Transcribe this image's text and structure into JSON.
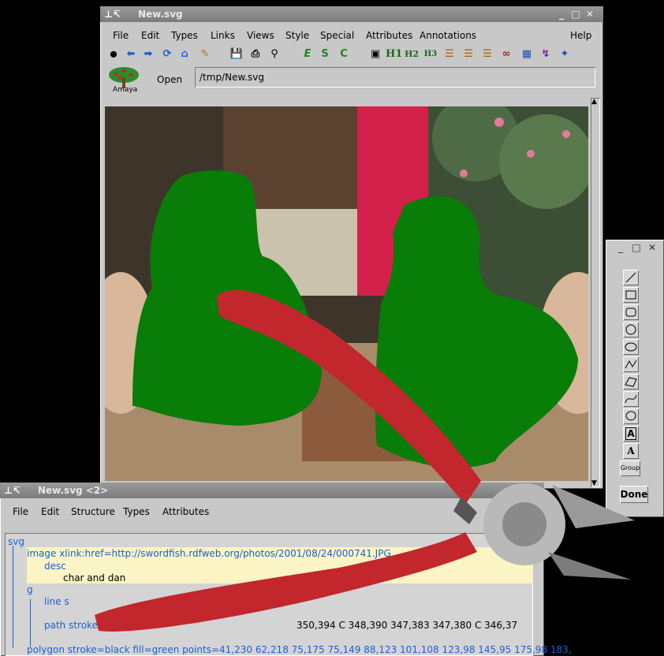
{
  "main_window": {
    "title": "New.svg",
    "menu": [
      "File",
      "Edit",
      "Types",
      "Links",
      "Views",
      "Style",
      "Special",
      "Attributes",
      "Annotations",
      "Help"
    ],
    "toolbar_icons": [
      "stop-icon",
      "back-icon",
      "forward-icon",
      "reload-icon",
      "home-icon",
      "edit-icon",
      "save-icon",
      "print-icon",
      "find-icon",
      "emphasis-icon",
      "strong-icon",
      "code-icon",
      "image-icon",
      "h1-icon",
      "h2-icon",
      "h3-icon",
      "list-icon",
      "numbered-list-icon",
      "definition-list-icon",
      "link-icon",
      "table-icon",
      "math-icon",
      "graphics-icon"
    ],
    "toolbar_glyphs": {
      "emph": "E",
      "strong": "S",
      "code": "C",
      "h1": "H1",
      "h2": "H2",
      "h3": "H3"
    },
    "logo_label": "Amaya",
    "open_label": "Open",
    "url_value": "/tmp/New.svg"
  },
  "palette": {
    "tools": [
      "line-tool",
      "rect-tool",
      "rounded-rect-tool",
      "circle-tool",
      "ellipse-tool",
      "polyline-tool",
      "polygon-tool",
      "curve-tool",
      "closed-curve-tool",
      "foreign-text-tool",
      "text-tool",
      "group-tool"
    ],
    "text_tool_label": "A",
    "group_label": "Group",
    "done_label": "Done"
  },
  "structure_window": {
    "title": "New.svg <2>",
    "menu": [
      "File",
      "Edit",
      "Structure",
      "Types",
      "Attributes"
    ],
    "tree": {
      "svg": "svg",
      "image_line": "image xlink:href=http://swordfish.rdfweb.org/photos/2001/08/24/000741.JPG",
      "desc": "desc",
      "desc_text": "char  and dan",
      "g": "g",
      "line": "line s",
      "path": "path stroke=b",
      "path_tail": "350,394 C 348,390 347,383 347,380 C 346,37",
      "polygon": "polygon stroke=black fill=green points=41,230 62,218 75,175 75,149 88,123 101,108 123,98 145,95 175,98 183,"
    }
  },
  "colors": {
    "accent": "#1b5fd0",
    "fill_green": "#0a7a0a",
    "handle_red": "#c2272d"
  }
}
